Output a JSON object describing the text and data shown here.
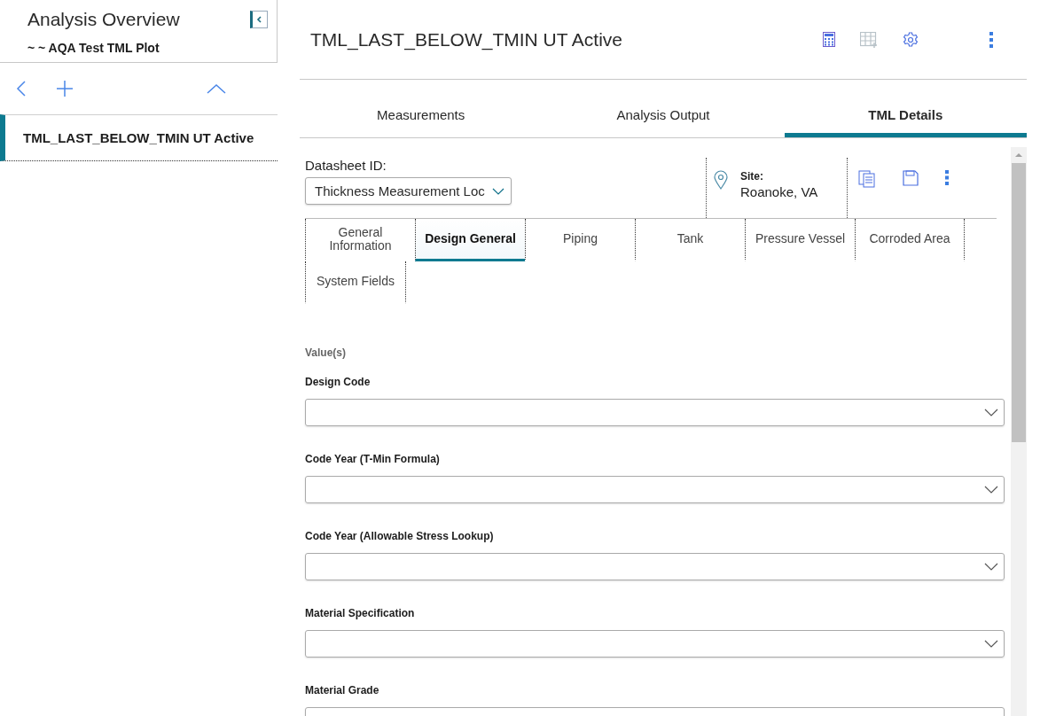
{
  "sidebar": {
    "title": "Analysis Overview",
    "subtitle": "~ ~ AQA Test TML Plot",
    "items": [
      {
        "label": "TML_LAST_BELOW_TMIN UT Active",
        "selected": true
      }
    ]
  },
  "header": {
    "title": "TML_LAST_BELOW_TMIN UT Active"
  },
  "tabs": [
    {
      "label": "Measurements",
      "selected": false
    },
    {
      "label": "Analysis Output",
      "selected": false
    },
    {
      "label": "TML Details",
      "selected": true
    }
  ],
  "datasheet": {
    "label": "Datasheet ID:",
    "value": "Thickness Measurement Loc"
  },
  "site": {
    "label": "Site:",
    "value": "Roanoke, VA"
  },
  "subtabs": [
    {
      "label": "General Information",
      "selected": false
    },
    {
      "label": "Design General",
      "selected": true
    },
    {
      "label": "Piping",
      "selected": false
    },
    {
      "label": "Tank",
      "selected": false
    },
    {
      "label": "Pressure Vessel",
      "selected": false
    },
    {
      "label": "Corroded Area",
      "selected": false
    },
    {
      "label": "System Fields",
      "selected": false
    }
  ],
  "section_label": "Value(s)",
  "fields": [
    {
      "label": "Design Code"
    },
    {
      "label": "Code Year (T-Min Formula)"
    },
    {
      "label": "Code Year (Allowable Stress Lookup)"
    },
    {
      "label": "Material Specification"
    },
    {
      "label": "Material Grade"
    }
  ]
}
